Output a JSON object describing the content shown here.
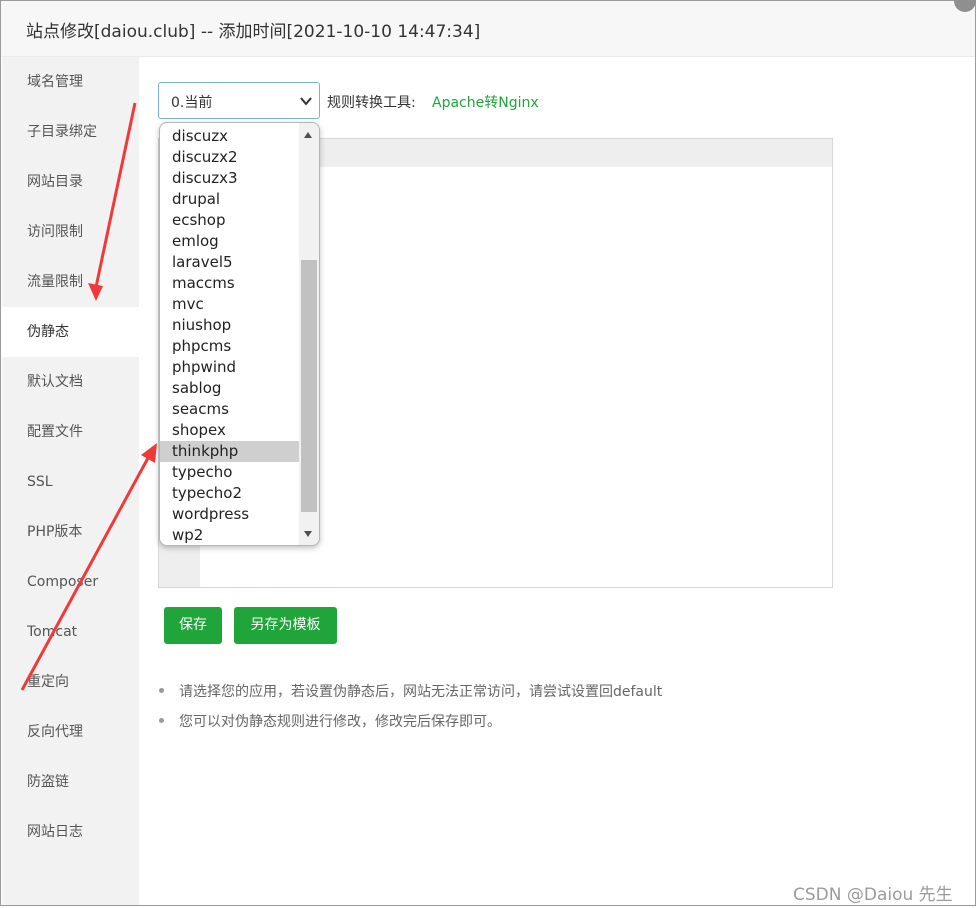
{
  "dialog": {
    "title": "站点修改[daiou.club] -- 添加时间[2021-10-10 14:47:34]"
  },
  "sidebar": {
    "items": [
      {
        "label": "域名管理"
      },
      {
        "label": "子目录绑定"
      },
      {
        "label": "网站目录"
      },
      {
        "label": "访问限制"
      },
      {
        "label": "流量限制"
      },
      {
        "label": "伪静态",
        "active": true
      },
      {
        "label": "默认文档"
      },
      {
        "label": "配置文件"
      },
      {
        "label": "SSL"
      },
      {
        "label": "PHP版本"
      },
      {
        "label": "Composer"
      },
      {
        "label": "Tomcat"
      },
      {
        "label": "重定向"
      },
      {
        "label": "反向代理"
      },
      {
        "label": "防盗链"
      },
      {
        "label": "网站日志"
      }
    ]
  },
  "rewrite": {
    "select_value": "0.当前",
    "tool_label": "规则转换工具:",
    "tool_link": "Apache转Nginx",
    "dropdown_options": [
      "discuzx",
      "discuzx2",
      "discuzx3",
      "drupal",
      "ecshop",
      "emlog",
      "laravel5",
      "maccms",
      "mvc",
      "niushop",
      "phpcms",
      "phpwind",
      "sablog",
      "seacms",
      "shopex",
      "thinkphp",
      "typecho",
      "typecho2",
      "wordpress",
      "wp2"
    ],
    "highlighted_option": "thinkphp",
    "save_label": "保存",
    "save_template_label": "另存为模板",
    "tips": [
      "请选择您的应用，若设置伪静态后，网站无法正常访问，请尝试设置回default",
      "您可以对伪静态规则进行修改，修改完后保存即可。"
    ]
  },
  "watermark": "CSDN @Daiou 先生",
  "colors": {
    "accent_green": "#20a53a",
    "annotation_red": "#f03a3a",
    "sidebar_bg": "#f2f2f2"
  }
}
